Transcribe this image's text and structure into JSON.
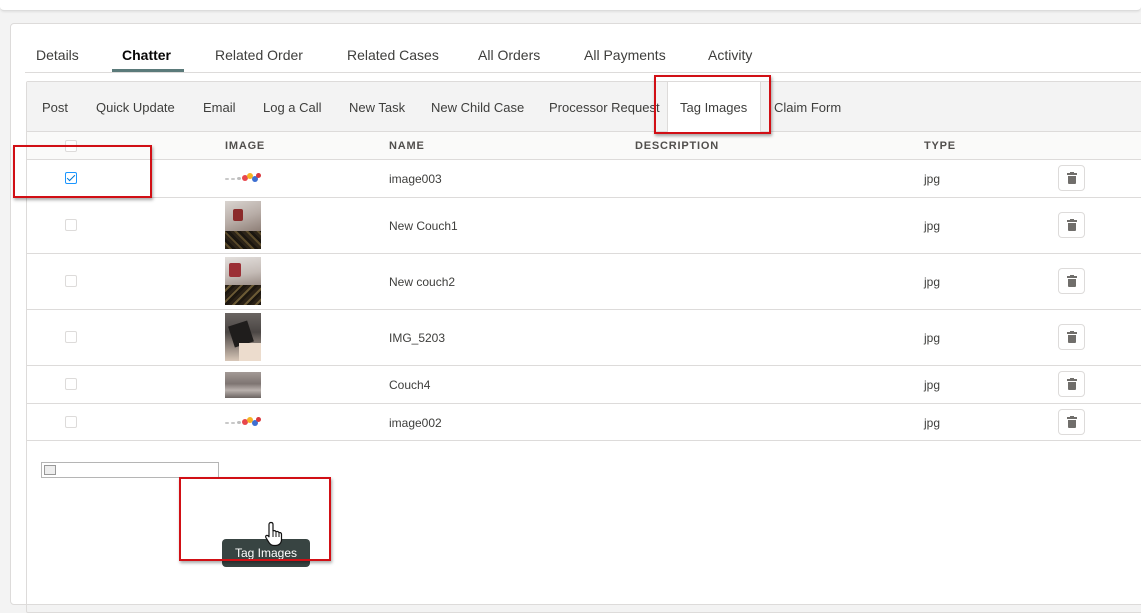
{
  "top_tabs": [
    {
      "label": "Details"
    },
    {
      "label": "Chatter"
    },
    {
      "label": "Related Order"
    },
    {
      "label": "Related Cases"
    },
    {
      "label": "All Orders"
    },
    {
      "label": "All Payments"
    },
    {
      "label": "Activity"
    }
  ],
  "active_top_tab": "Chatter",
  "action_tabs": [
    {
      "label": "Post"
    },
    {
      "label": "Quick Update"
    },
    {
      "label": "Email"
    },
    {
      "label": "Log a Call"
    },
    {
      "label": "New Task"
    },
    {
      "label": "New Child Case"
    },
    {
      "label": "Processor Request"
    },
    {
      "label": "Tag Images"
    },
    {
      "label": "Claim Form"
    }
  ],
  "active_action_tab": "Tag Images",
  "table": {
    "columns": {
      "image": "IMAGE",
      "name": "NAME",
      "description": "DESCRIPTION",
      "type": "TYPE"
    },
    "rows": [
      {
        "name": "image003",
        "description": "",
        "type": "jpg",
        "checked": true,
        "thumb": "logo-dots"
      },
      {
        "name": "New Couch1",
        "description": "",
        "type": "jpg",
        "checked": false,
        "thumb": "photo-couch"
      },
      {
        "name": "New couch2",
        "description": "",
        "type": "jpg",
        "checked": false,
        "thumb": "photo-couch"
      },
      {
        "name": "IMG_5203",
        "description": "",
        "type": "jpg",
        "checked": false,
        "thumb": "photo-dark"
      },
      {
        "name": "Couch4",
        "description": "",
        "type": "jpg",
        "checked": false,
        "thumb": "photo-gray"
      },
      {
        "name": "image002",
        "description": "",
        "type": "jpg",
        "checked": false,
        "thumb": "logo-dots"
      }
    ]
  },
  "tag_images_button": {
    "label": "Tag Images"
  },
  "icons": {
    "delete": "trash-icon",
    "cursor": "hand-pointer-icon",
    "broken_image": "broken-image-icon"
  },
  "colors": {
    "highlight": "#d10f15",
    "button_bg": "#384442",
    "tab_underline": "#5b7a7a",
    "checkbox_check": "#0176d3"
  }
}
